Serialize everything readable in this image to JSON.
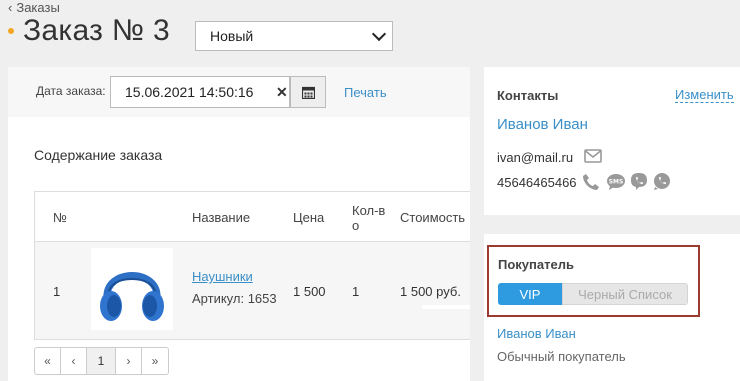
{
  "header": {
    "back_label": "Заказы",
    "title": "Заказ № 3",
    "status_value": "Новый"
  },
  "order": {
    "date_label": "Дата заказа:",
    "date_value": "15.06.2021 14:50:16",
    "print_label": "Печать",
    "section_title": "Содержание заказа"
  },
  "table": {
    "columns": [
      "№",
      "Название",
      "Цена",
      "Кол-во",
      "Стоимость"
    ],
    "rows": [
      {
        "num": "1",
        "name": "Наушники",
        "sku": "Артикул: 1653",
        "price": "1 500",
        "qty": "1",
        "total": "1 500 руб."
      }
    ]
  },
  "pager": {
    "first": "«",
    "prev": "‹",
    "page": "1",
    "next": "›",
    "last": "»"
  },
  "contacts": {
    "heading": "Контакты",
    "edit_label": "Изменить",
    "name": "Иванов Иван",
    "email": "ivan@mail.ru",
    "phone": "45646465466"
  },
  "buyer": {
    "heading": "Покупатель",
    "vip_label": "VIP",
    "blacklist_label": "Черный Список",
    "name": "Иванов Иван",
    "type": "Обычный покупатель"
  },
  "colors": {
    "accent": "#3a8fc8",
    "vip": "#2e9ae0",
    "highlight_border": "#9b3a2f",
    "title_dot": "#f5a623"
  }
}
